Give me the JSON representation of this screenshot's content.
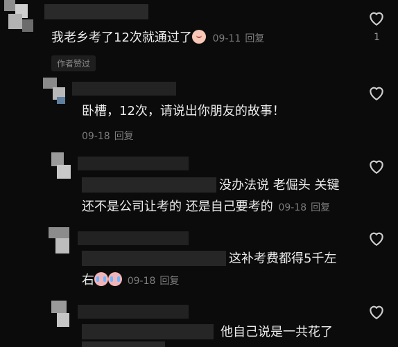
{
  "comments": [
    {
      "text": "我老乡考了12次就通过了",
      "emoji": "peach-face",
      "date": "09-11",
      "reply": "回复",
      "likes": "1",
      "badge": "作者赞过"
    },
    {
      "text": "卧槽，12次，请说出你朋友的故事！",
      "date": "09-18",
      "reply": "回复"
    },
    {
      "line1": "没办法说 老倔头 关键",
      "line2": "还不是公司让考的 还是自己要考的",
      "date": "09-18",
      "reply": "回复"
    },
    {
      "line1": "这补考费都得5千左",
      "line2": "右",
      "emoji": "crying-face",
      "date": "09-18",
      "reply": "回复"
    },
    {
      "line1": "他自己说是一共花了"
    }
  ],
  "icons": {
    "like": "heart-outline-icon",
    "color_text": "#ececec",
    "color_meta": "#7d7d7d",
    "color_bg": "#0b0b0b"
  }
}
